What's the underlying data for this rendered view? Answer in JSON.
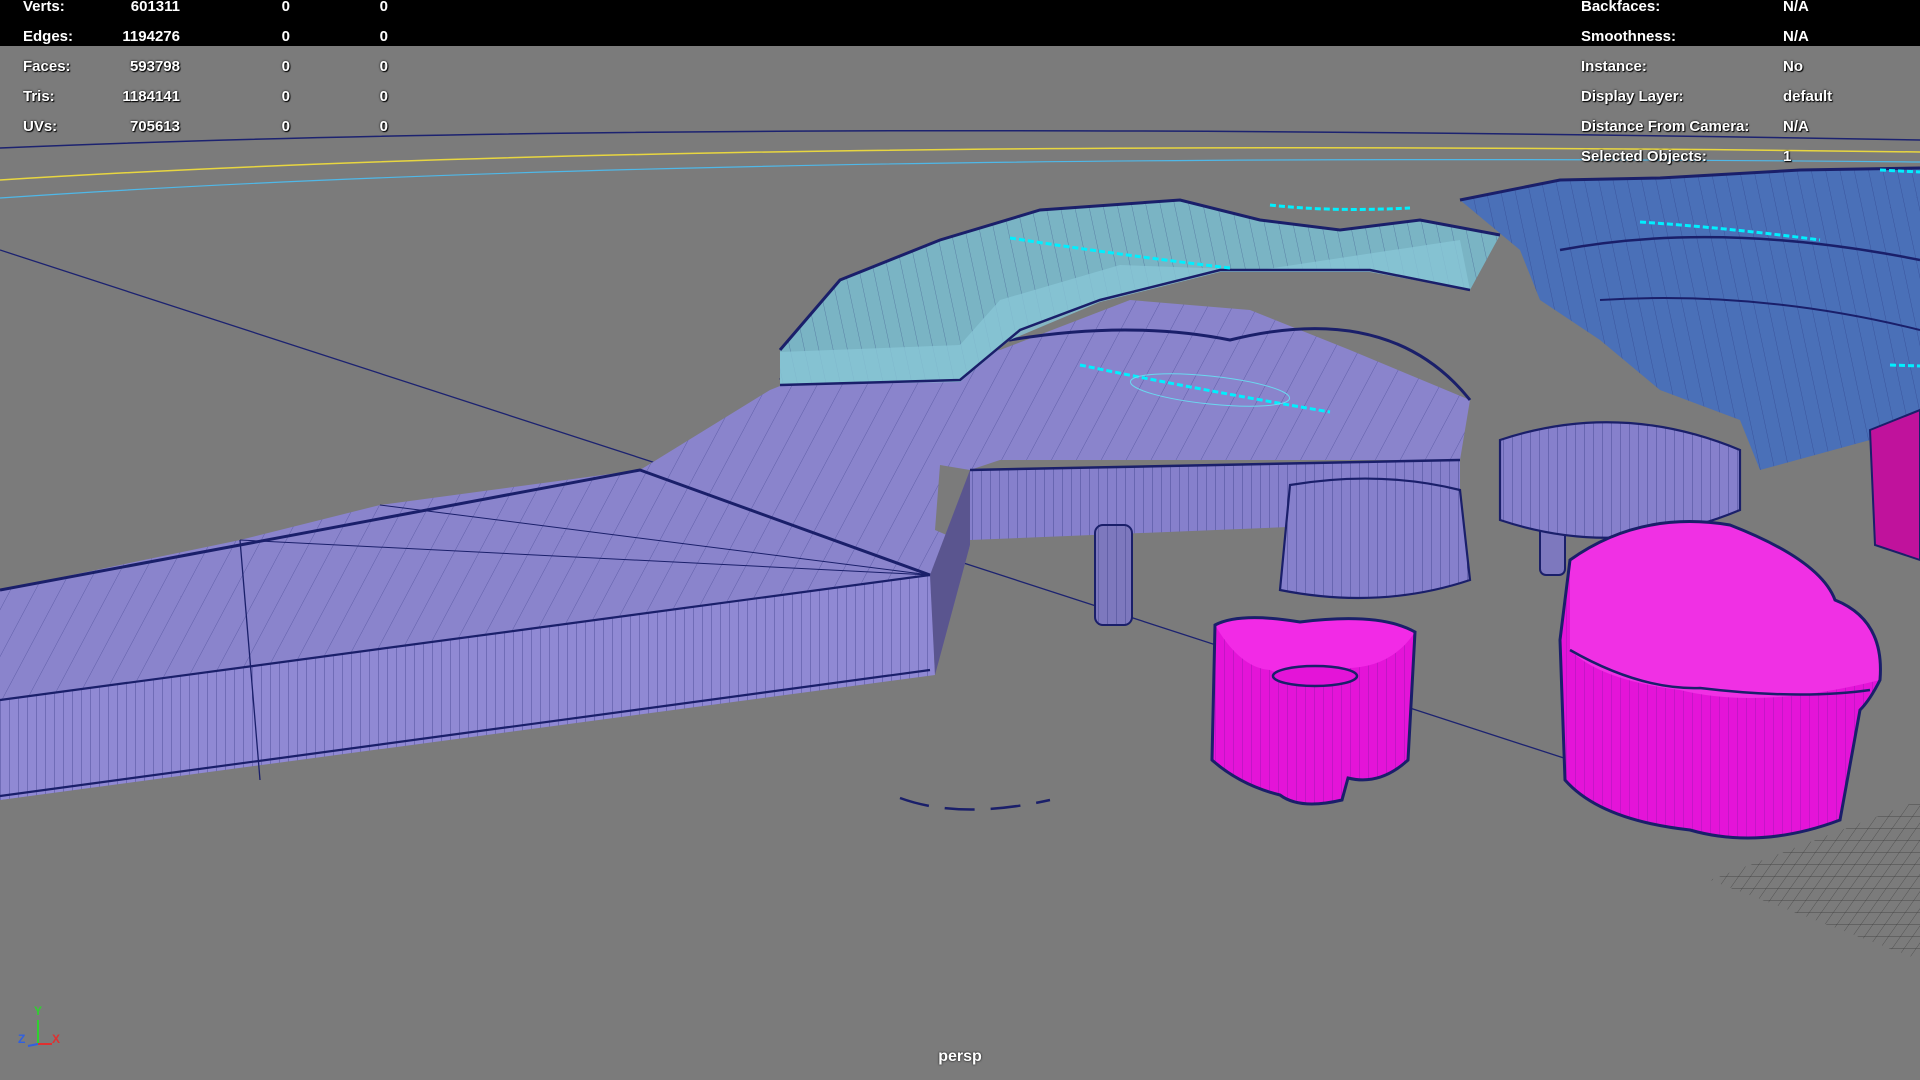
{
  "heads_up_display": {
    "poly_count": [
      {
        "label": "Verts:",
        "value": "601311",
        "selected": "0",
        "component": "0"
      },
      {
        "label": "Edges:",
        "value": "1194276",
        "selected": "0",
        "component": "0"
      },
      {
        "label": "Faces:",
        "value": "593798",
        "selected": "0",
        "component": "0"
      },
      {
        "label": "Tris:",
        "value": "1184141",
        "selected": "0",
        "component": "0"
      },
      {
        "label": "UVs:",
        "value": "705613",
        "selected": "0",
        "component": "0"
      }
    ],
    "object_details": [
      {
        "label": "Backfaces:",
        "value": "N/A"
      },
      {
        "label": "Smoothness:",
        "value": "N/A"
      },
      {
        "label": "Instance:",
        "value": "No"
      },
      {
        "label": "Display Layer:",
        "value": "default"
      },
      {
        "label": "Distance From Camera:",
        "value": "N/A"
      },
      {
        "label": "Selected Objects:",
        "value": "1"
      }
    ]
  },
  "viewport": {
    "camera_name": "persp",
    "background_color": "#7b7b7b",
    "axis_gizmo": {
      "x": "X",
      "y": "Y",
      "z": "Z",
      "x_color": "#e03030",
      "y_color": "#30d030",
      "z_color": "#3060e0"
    }
  },
  "colors": {
    "lavender_mesh": "#8a84cc",
    "teal_mesh": "#7ab4c4",
    "blue_mesh": "#4a70b8",
    "magenta_mesh": "#e414d8",
    "wireframe": "#1a1f6a",
    "selection_highlight": "#00f0ff"
  }
}
